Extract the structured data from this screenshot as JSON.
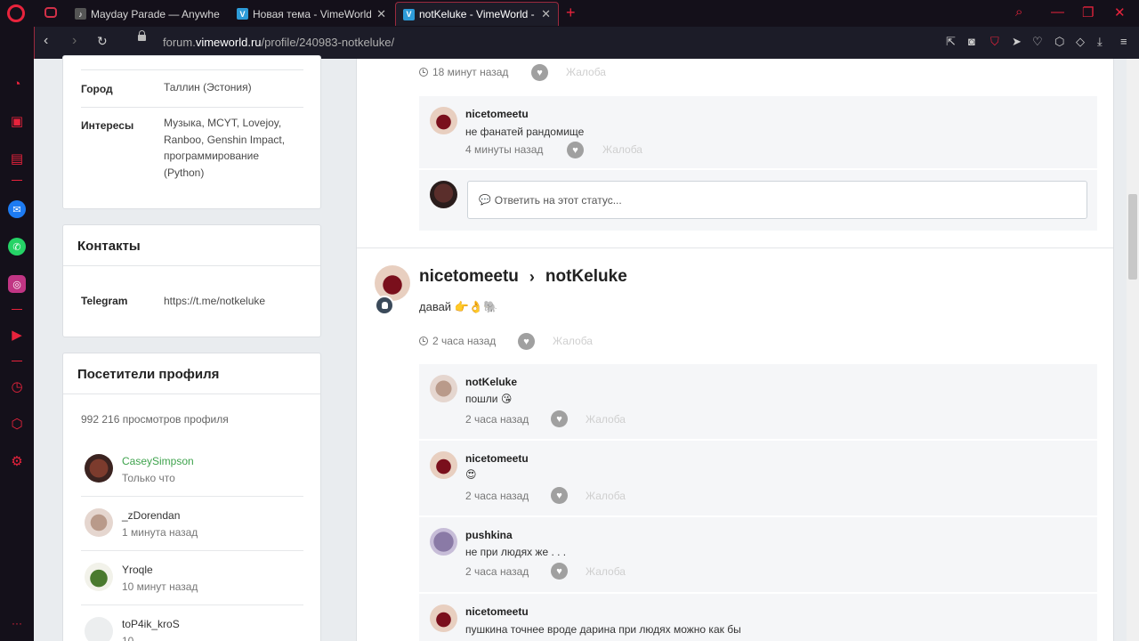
{
  "browser": {
    "tabs": [
      {
        "title": "Mayday Parade — Anywhe",
        "favicon": "music-icon"
      },
      {
        "title": "Новая тема - VimeWorld",
        "favicon": "vimeworld-icon"
      },
      {
        "title": "notKeluke - VimeWorld - Ф",
        "favicon": "vimeworld-icon"
      }
    ],
    "new_tab": "+",
    "url_prefix": "forum.",
    "url_domain": "vimeworld.ru",
    "url_path": "/profile/240983-notkeluke/"
  },
  "profile": {
    "about": {
      "city_label": "Город",
      "city_value": "Таллин (Эстония)",
      "interests_label": "Интересы",
      "interests_value": "Музыка, MCYT, Lovejoy, Ranboo, Genshin Impact, программирование (Python)"
    },
    "contacts": {
      "title": "Контакты",
      "telegram_label": "Telegram",
      "telegram_value": "https://t.me/notkeluke"
    },
    "visitors": {
      "title": "Посетители профиля",
      "views": "992 216 просмотров профиля",
      "items": [
        {
          "name": "CaseySimpson",
          "time": "Только что"
        },
        {
          "name": "_zDorendan",
          "time": "1 минута назад"
        },
        {
          "name": "Yroqle",
          "time": "10 минут назад"
        },
        {
          "name": "toP4ik_kroS",
          "time": "10"
        }
      ]
    }
  },
  "feed": {
    "report_label": "Жалоба",
    "top_meta": "18 минут назад",
    "top_reply": {
      "name": "nicetomeetu",
      "text": "не фанатей рандомище",
      "time": "4 минуты назад"
    },
    "reply_placeholder": "Ответить на этот статус...",
    "status": {
      "author": "nicetomeetu",
      "arrow": "›",
      "target": "notKeluke",
      "text": "давай 👉👌🐘",
      "time": "2 часа назад"
    },
    "replies": [
      {
        "name": "notKeluke",
        "text": "пошли 😘",
        "time": "2 часа назад"
      },
      {
        "name": "nicetomeetu",
        "text": "😍",
        "time": "2 часа назад"
      },
      {
        "name": "pushkina",
        "text": "не при людях же . . .",
        "time": "2 часа назад"
      },
      {
        "name": "nicetomeetu",
        "text": "пушкина точнее вроде дарина при людях можно как бы",
        "time": ""
      }
    ]
  }
}
